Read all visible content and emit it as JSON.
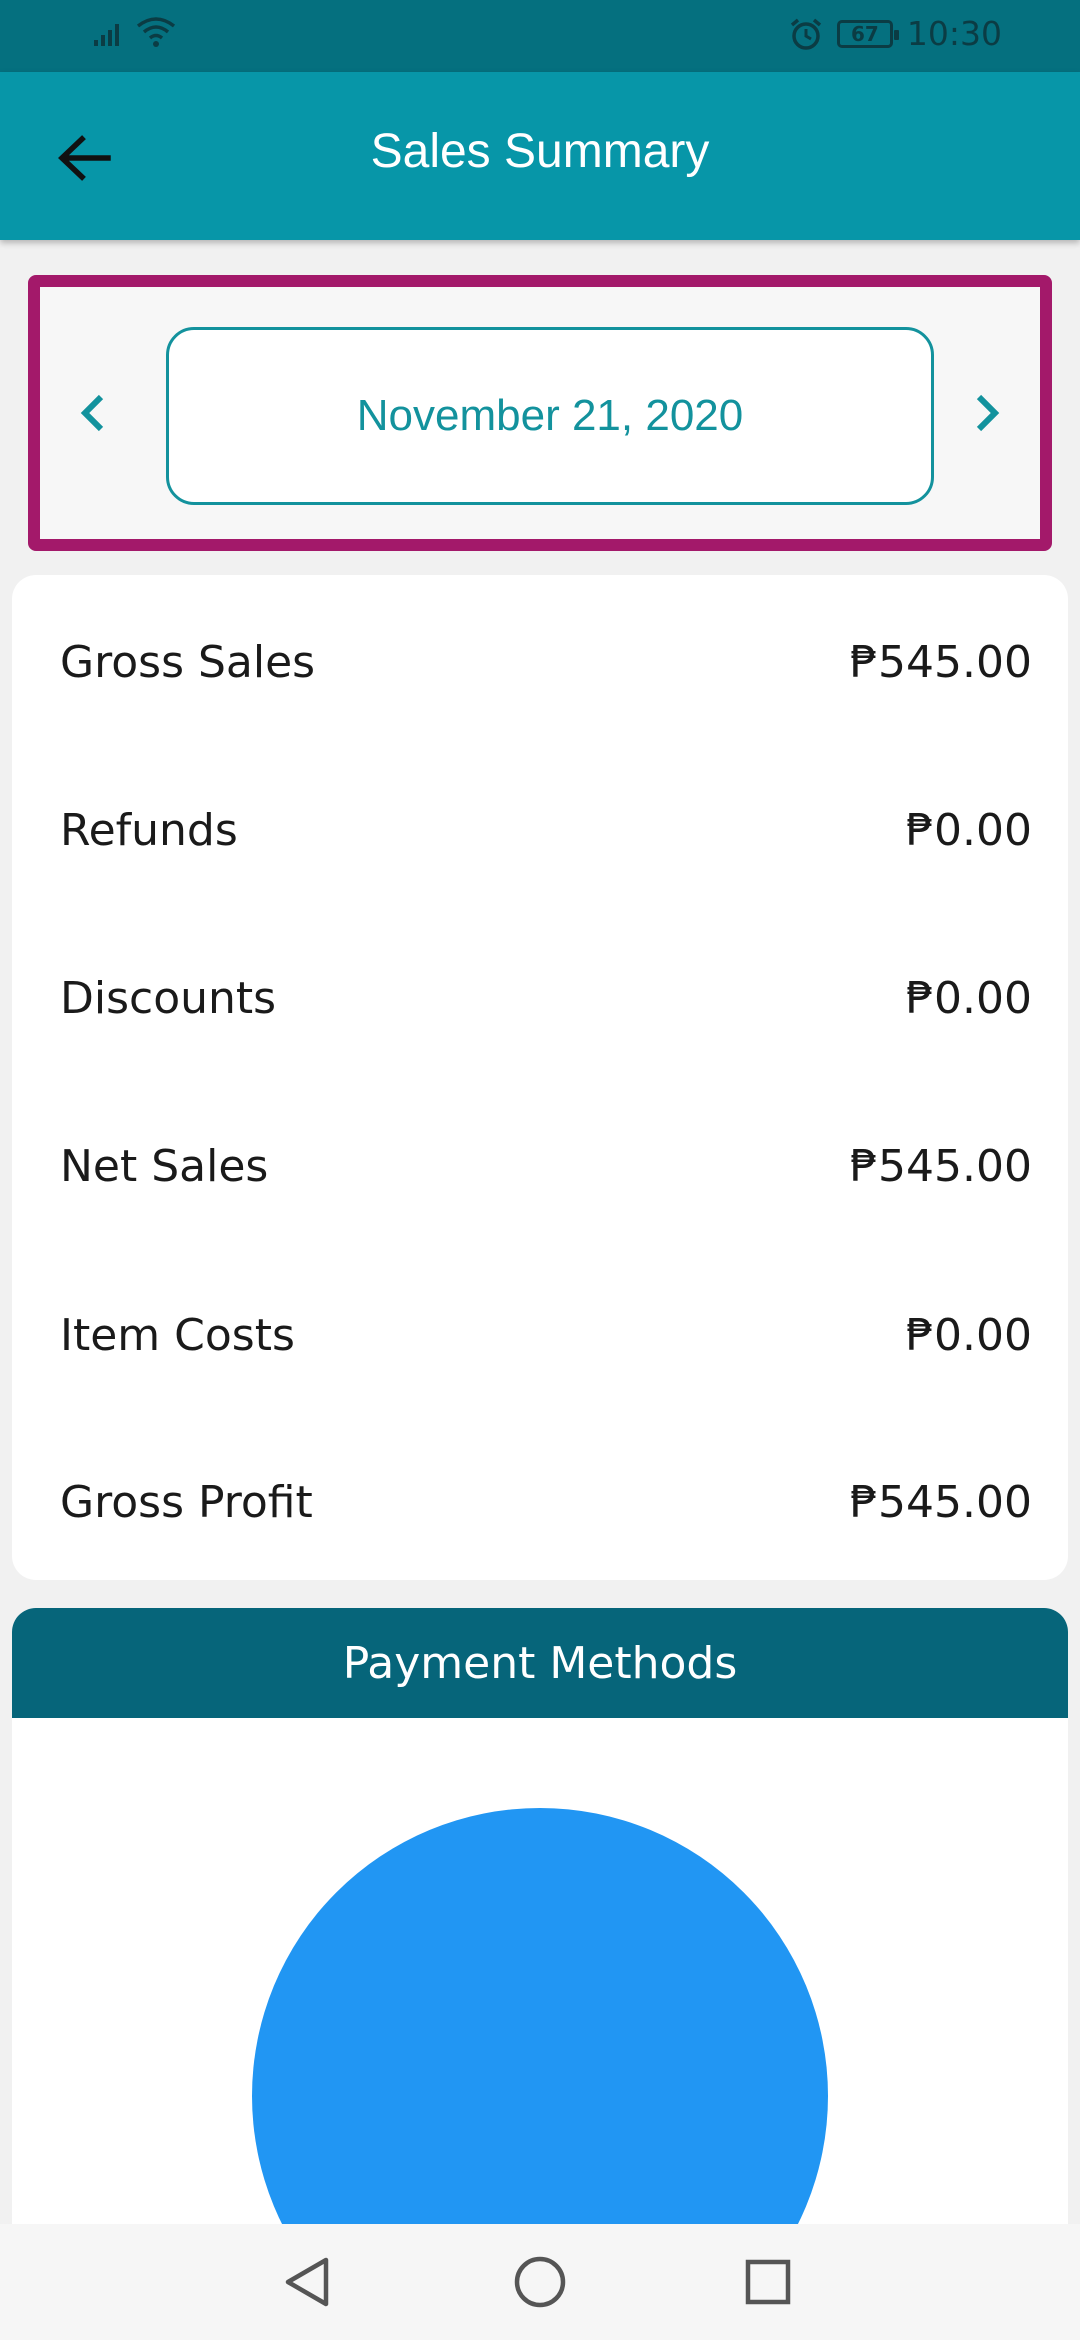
{
  "status_bar": {
    "battery": "67",
    "time": "10:30",
    "icons": [
      "signal-icon",
      "wifi-icon",
      "alarm-icon",
      "battery-icon"
    ]
  },
  "app_bar": {
    "title": "Sales Summary",
    "back_icon": "arrow-left-icon"
  },
  "date_selector": {
    "date": "November 21, 2020",
    "prev_icon": "chevron-left-icon",
    "next_icon": "chevron-right-icon"
  },
  "summary": {
    "rows": [
      {
        "label": "Gross Sales",
        "value": "₱545.00"
      },
      {
        "label": "Refunds",
        "value": "₱0.00"
      },
      {
        "label": "Discounts",
        "value": "₱0.00"
      },
      {
        "label": "Net Sales",
        "value": "₱545.00"
      },
      {
        "label": "Item Costs",
        "value": "₱0.00"
      },
      {
        "label": "Gross Profit",
        "value": "₱545.00"
      }
    ]
  },
  "payment_methods": {
    "title": "Payment Methods",
    "pie_color": "#2196f3"
  },
  "nav_bar": {
    "icons": [
      "back-triangle-icon",
      "home-circle-icon",
      "recents-square-icon"
    ]
  },
  "colors": {
    "primary": "#0796a8",
    "status_bar": "#05707f",
    "highlight": "#a3196a",
    "payment_header": "#06657a",
    "accent_text": "#13929d"
  }
}
